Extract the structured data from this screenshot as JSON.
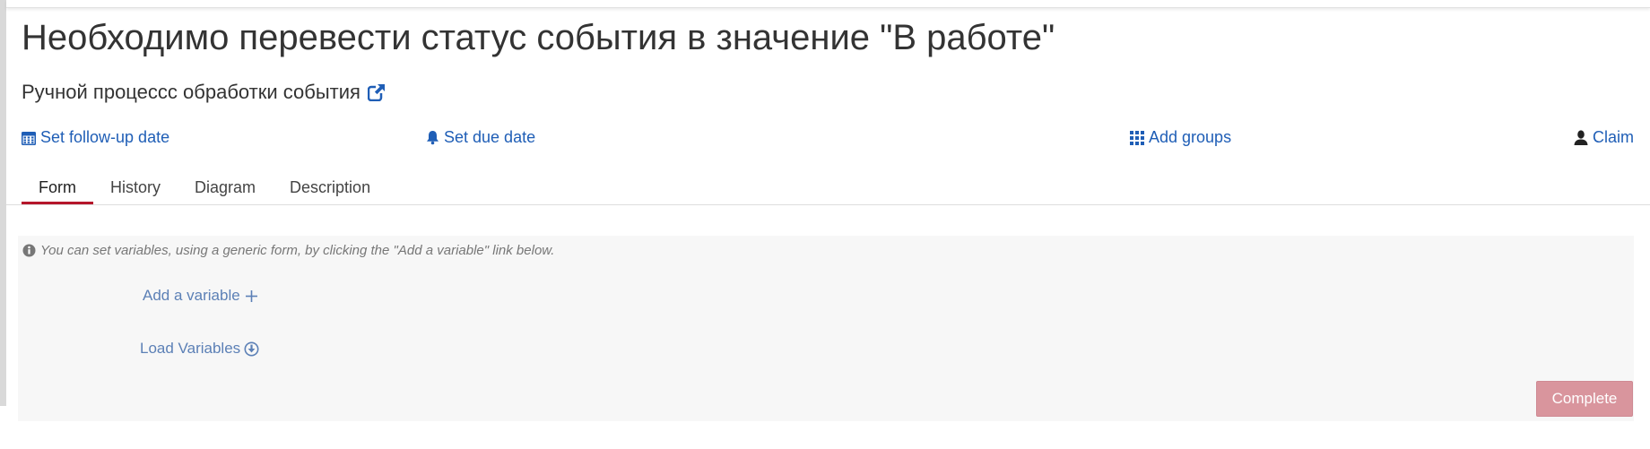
{
  "header": {
    "title": "Необходимо перевести статус события в значение \"В работе\"",
    "process_name": "Ручной процессс обработки события"
  },
  "actions": {
    "follow_up": "Set follow-up date",
    "due_date": "Set due date",
    "add_groups": "Add groups",
    "claim": "Claim"
  },
  "tabs": [
    {
      "label": "Form",
      "active": true
    },
    {
      "label": "History",
      "active": false
    },
    {
      "label": "Diagram",
      "active": false
    },
    {
      "label": "Description",
      "active": false
    }
  ],
  "form": {
    "info_text": "You can set variables, using a generic form, by clicking the \"Add a variable\" link below.",
    "add_variable": "Add a variable",
    "load_variables": "Load Variables",
    "complete_label": "Complete"
  },
  "colors": {
    "link": "#1f5eb6",
    "active_tab_underline": "#b5152b",
    "complete_button": "#d9959d",
    "panel_background": "#f7f7f7"
  },
  "icons": {
    "external_link": "external-link-icon",
    "calendar": "calendar-icon",
    "bell": "bell-icon",
    "groups": "grid-icon",
    "claim": "user-icon",
    "info": "info-circle-icon",
    "add": "plus-icon",
    "load": "download-circle-icon"
  }
}
